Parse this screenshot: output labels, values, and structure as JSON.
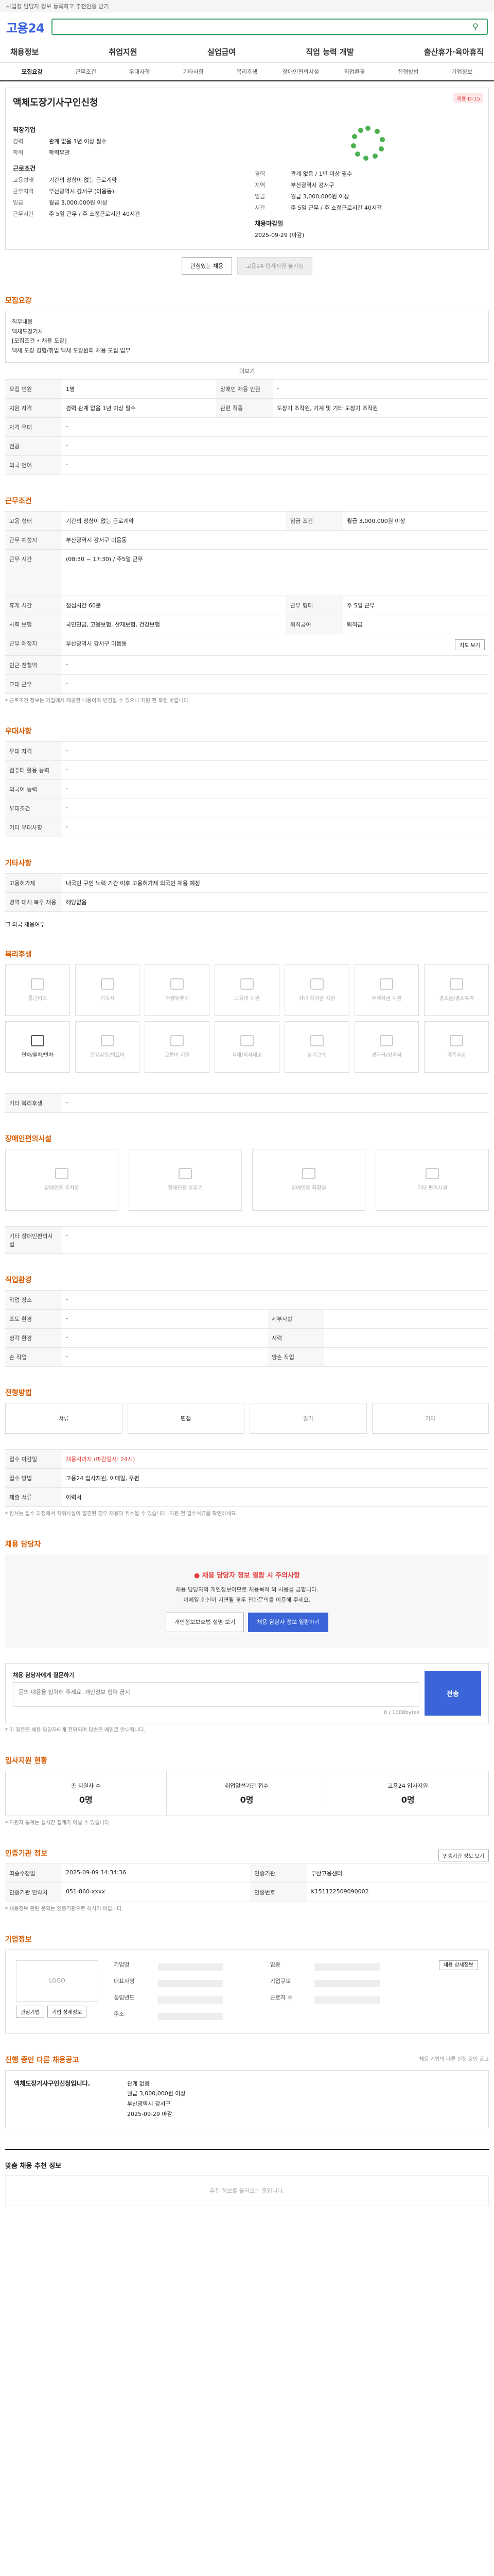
{
  "topbar": {
    "text": "사업장 담당자 정보 등록하고 추천인증 받기"
  },
  "header": {
    "logo": "고용24",
    "search_placeholder": ""
  },
  "gnb": [
    "채용정보",
    "취업지원",
    "실업급여",
    "직업 능력 개발",
    "출산휴가·육아휴직"
  ],
  "tabs": [
    "모집요강",
    "근무조건",
    "우대사항",
    "기타사항",
    "복리후생",
    "장애인편의시설",
    "직업환경",
    "전형방법",
    "기업정보"
  ],
  "job": {
    "badge": "채용 D-15",
    "title": "액체도장기사구인신청",
    "company_label": "직장기업",
    "company": "",
    "career_label": "경력",
    "career": "관계 없음 1년 이상 필수",
    "edu_label": "학력",
    "edu": "학력무관",
    "work_label": "근로조건",
    "emp_type_label": "고용형태",
    "emp_type": "기간의 정함이 없는 근로계약",
    "area_label": "근무지역",
    "area": "부산광역시 강서구 (미음동)",
    "pay_label": "임금",
    "pay": "월급 3,000,000원 이상",
    "hours_label": "근무시간",
    "hours": "주 5일 근무 / 주 소정근로시간 40시간",
    "right_rows": [
      {
        "k": "경력",
        "v": "관계 없음 / 1년 이상 필수"
      },
      {
        "k": "지역",
        "v": "부산광역시 강서구"
      },
      {
        "k": "임금",
        "v": "월급 3,000,000원 이상"
      },
      {
        "k": "시간",
        "v": "주 5일 근무 / 주 소정근로시간 40시간"
      }
    ],
    "deadline_label": "채용마감일",
    "deadline": "2025-09-29 (마감)",
    "btn_interest": "관심있는 채용",
    "btn_apply": "고용24 입사지원 불가능"
  },
  "recruit": {
    "title": "모집요강",
    "box_lines": [
      "직무내용",
      "액체도장기사",
      "",
      "[모집조건 • 채용 도장]",
      "",
      "액체 도장 경험/취업 액체 도장원의 채용 모집 업무"
    ],
    "more": "더보기",
    "rows": [
      [
        "모집 인원",
        "1명",
        "장애인 채용 인원",
        "-"
      ],
      [
        "지원 자격",
        "경력 관계 없음 1년 이상 필수",
        "관련 직종",
        "도장기 조작원, 기계 및 기타 도장기 조작원"
      ],
      [
        "자격 우대",
        "-",
        "",
        "",
        ""
      ],
      [
        "전공",
        "-",
        "",
        "",
        ""
      ],
      [
        "외국 언어",
        "-",
        "",
        "",
        ""
      ]
    ]
  },
  "conditions": {
    "title": "근무조건",
    "rows": [
      [
        "고용 형태",
        "기간의 정함이 없는 근로계약",
        "임금 조건",
        "월급 3,000,000원 이상"
      ],
      [
        "근무 예정지",
        "부산광역시 강서구 미음동",
        "",
        ""
      ],
      [
        "근무 시간",
        "(08:30 ~ 17:30) / 주5일 근무",
        "",
        ""
      ],
      [
        "휴게 시간",
        "점심시간 60분",
        "근무 형태",
        "주 5일 근무"
      ],
      [
        "사회 보험",
        "국민연금, 고용보험, 산재보험, 건강보험",
        "퇴직급여",
        "퇴직금"
      ],
      [
        "근무 예정지",
        "부산광역시 강서구 미음동",
        "",
        ""
      ],
      [
        "인근 전철역",
        "-",
        "",
        ""
      ],
      [
        "교대 근무",
        "-",
        "",
        ""
      ]
    ],
    "note": "* 근로조건 정보는 기업에서 제공한 내용이며 변경될 수 있으니 지원 전 확인 바랍니다.",
    "map_btn": "지도 보기"
  },
  "preference": {
    "title": "우대사항",
    "rows": [
      [
        "우대 자격",
        "-"
      ],
      [
        "컴퓨터 활용 능력",
        "-"
      ],
      [
        "외국어 능력",
        "-"
      ],
      [
        "우대조건",
        "-"
      ],
      [
        "기타 우대사항",
        "-"
      ]
    ]
  },
  "etc": {
    "title": "기타사항",
    "rows": [
      [
        "고용허가제",
        "내국인 구인 노력 기간 이후 고용허가제 외국인 채용 예정"
      ],
      [
        "병역 대체 복무 채용",
        "해당없음"
      ]
    ],
    "chk": "외국 채용여부"
  },
  "welfare": {
    "title": "복리후생",
    "items": [
      "통근버스",
      "기숙사",
      "차량유류비",
      "교육비 지원",
      "자녀 학자금 지원",
      "주택자금 지원",
      "경조금/경조휴가",
      "연차/월차/반차",
      "건강검진/의료비",
      "교통비 지원",
      "식대/식사제공",
      "장기근속",
      "성과급/상여금",
      "가족수당"
    ],
    "on_index": 7,
    "etc_label": "기타 복리후생",
    "etc_value": "-"
  },
  "facility": {
    "title": "장애인편의시설",
    "items": [
      "장애인용 주차장",
      "장애인용 승강기",
      "장애인용 화장실",
      "기타 편의시설"
    ],
    "etc_label": "기타 장애인편의시설",
    "etc_value": "-"
  },
  "env": {
    "title": "직업환경",
    "rows": [
      [
        "작업 장소",
        "-",
        "",
        ""
      ],
      [
        "조도 환경",
        "-",
        "세부사항",
        ""
      ],
      [
        "청각 환경",
        "-",
        "시력",
        ""
      ],
      [
        "손 작업",
        "-",
        "양손 작업",
        ""
      ]
    ]
  },
  "process": {
    "title": "전형방법",
    "steps": [
      "서류",
      "면접",
      "필기",
      "기타"
    ],
    "on": [
      0,
      1
    ],
    "rows": [
      [
        "접수 마감일",
        "채용시까지 (마감일시: 24시)"
      ],
      [
        "접수 방법",
        "고용24 입사지원, 이메일, 우편"
      ],
      [
        "제출 서류",
        "이력서"
      ]
    ],
    "notes": "* 원서는 접수 과정에서 허위사실이 발견된 경우 채용이 취소될 수 있습니다. 지원 전 필수서류를 확인하세요."
  },
  "contact": {
    "title": "채용 담당자",
    "alert_h": "채용 담당자 정보 열람 시 주의사항",
    "alert_lines": [
      "채용 담당자의 개인정보이므로 채용목적 외 사용을 금합니다.",
      "이메일 회신이 지연될 경우 전화문의를 이용해 주세요."
    ],
    "btn1": "개인정보보호법 설명 보기",
    "btn2": "채용 담당자 정보 열람하기",
    "qa_label": "채용 담당자에게 질문하기",
    "qa_placeholder": "문의 내용을 입력해 주세요. 개인정보 입력 금지.",
    "qa_count": "0 / 1000bytes",
    "send": "전송",
    "qa_notes": "* 이 질문은 채용 담당자에게 전달되며 답변은 메일로 안내됩니다."
  },
  "apply_stats": {
    "title": "입사지원 현황",
    "items": [
      {
        "label": "총 지원자 수",
        "value": "0명"
      },
      {
        "label": "취업알선기관 접수",
        "value": "0명"
      },
      {
        "label": "고용24 입사지원",
        "value": "0명"
      }
    ],
    "note": "* 지원자 통계는 실시간 집계가 아닐 수 있습니다."
  },
  "agency": {
    "title": "인증기관 정보",
    "btn": "인증기관 정보 보기",
    "rows": [
      [
        "최종수정일",
        "2025-09-09 14:34:36",
        "인증기관",
        "부산고용센터"
      ],
      [
        "인증기관 연락처",
        "051-860-xxxx",
        "인증번호",
        "K151122509090002"
      ]
    ],
    "note": "* 채용정보 관련 문의는 인증기관으로 하시기 바랍니다."
  },
  "company_info": {
    "title": "기업정보",
    "logo": "LOGO",
    "btn_a": "관심기업",
    "btn_b": "기업 상세정보",
    "labels": [
      "기업명",
      "업종",
      "대표자명",
      "기업규모",
      "설립년도",
      "근로자 수",
      "주소"
    ],
    "detail_btn": "채용 상세정보"
  },
  "others": {
    "title": "진행 중인 다른 채용공고",
    "sub": "채용 기업의 다른 진행 중인 공고",
    "company": "액체도장기사구인신청입니다.",
    "rows": [
      "관계 없음",
      "월급 3,000,000원 이상",
      "부산광역시 강서구",
      "2025-09-29 마감"
    ]
  },
  "recommend": {
    "title": "맞춤 채용 추천 정보",
    "loading": "추천 정보를 불러오는 중입니다."
  }
}
